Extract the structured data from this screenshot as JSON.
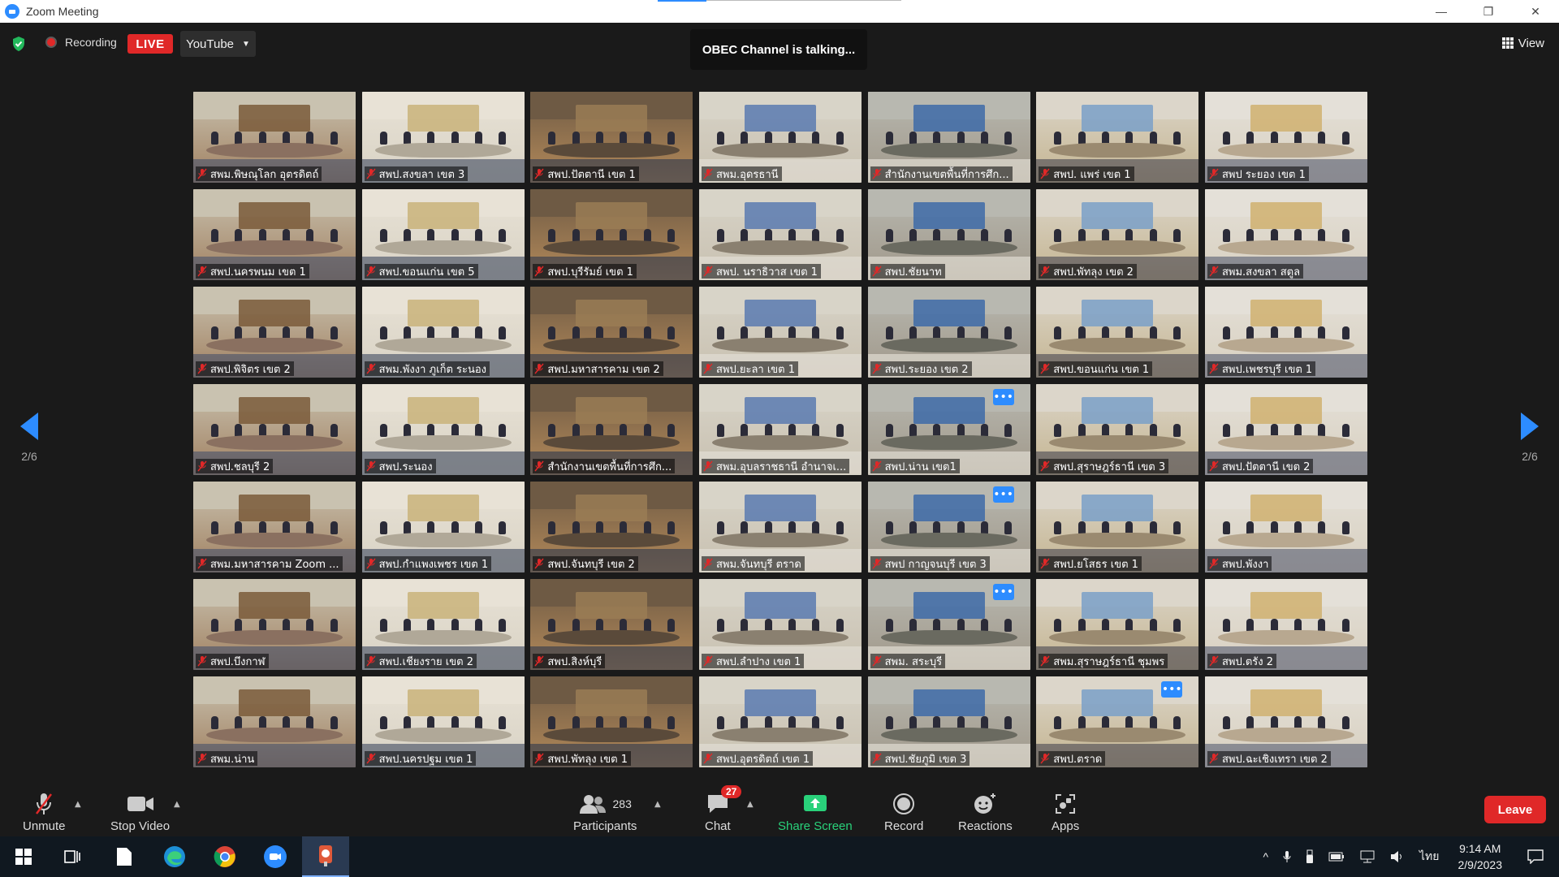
{
  "window": {
    "title": "Zoom Meeting",
    "controls": [
      "—",
      "❐",
      "✕"
    ]
  },
  "topbar": {
    "recording_label": "Recording",
    "live_label": "LIVE",
    "stream_target": "YouTube",
    "talking_status": "OBEC Channel is talking...",
    "view_label": "View"
  },
  "nav": {
    "page_left": "2/6",
    "page_right": "2/6"
  },
  "participants": [
    {
      "name": "สพม.พิษณุโลก อุตรดิตถ์",
      "muted": true,
      "more": false
    },
    {
      "name": "สพป.สงขลา เขต 3",
      "muted": true,
      "more": false
    },
    {
      "name": "สพป.ปัตตานี เขต 1",
      "muted": true,
      "more": false
    },
    {
      "name": "สพม.อุดรธานี",
      "muted": true,
      "more": false
    },
    {
      "name": "สำนักงานเขตพื้นที่การศึก...",
      "muted": true,
      "more": false
    },
    {
      "name": "สพป. แพร่ เขต 1",
      "muted": true,
      "more": false
    },
    {
      "name": "สพป ระยอง เขต 1",
      "muted": true,
      "more": false
    },
    {
      "name": "สพป.นครพนม เขต 1",
      "muted": true,
      "more": false
    },
    {
      "name": "สพป.ขอนแก่น เขต 5",
      "muted": true,
      "more": false
    },
    {
      "name": "สพป.บุรีรัมย์ เขต 1",
      "muted": true,
      "more": false
    },
    {
      "name": "สพป. นราธิวาส เขต 1",
      "muted": true,
      "more": false
    },
    {
      "name": "สพป.ชัยนาท",
      "muted": true,
      "more": false
    },
    {
      "name": "สพป.พัทลุง เขต 2",
      "muted": true,
      "more": false
    },
    {
      "name": "สพม.สงขลา สตูล",
      "muted": true,
      "more": false
    },
    {
      "name": "สพป.พิจิตร เขต 2",
      "muted": true,
      "more": false
    },
    {
      "name": "สพม.พังงา ภูเก็ต ระนอง",
      "muted": true,
      "more": false
    },
    {
      "name": "สพป.มหาสารคาม เขต 2",
      "muted": true,
      "more": false
    },
    {
      "name": "สพป.ยะลา เขต 1",
      "muted": true,
      "more": false
    },
    {
      "name": "สพป.ระยอง เขต 2",
      "muted": true,
      "more": false
    },
    {
      "name": "สพป.ขอนแก่น เขต 1",
      "muted": true,
      "more": false
    },
    {
      "name": "สพป.เพชรบุรี เขต 1",
      "muted": true,
      "more": false
    },
    {
      "name": "สพป.ชลบุรี 2",
      "muted": true,
      "more": false
    },
    {
      "name": "สพป.ระนอง",
      "muted": true,
      "more": false
    },
    {
      "name": "สำนักงานเขตพื้นที่การศึก...",
      "muted": true,
      "more": false
    },
    {
      "name": "สพม.อุบลราชธานี อำนาจเ...",
      "muted": true,
      "more": false
    },
    {
      "name": "สพป.น่าน เขต1",
      "muted": true,
      "more": true
    },
    {
      "name": "สพป.สุราษฎร์ธานี เขต 3",
      "muted": true,
      "more": false
    },
    {
      "name": "สพป.ปัตตานี เขต 2",
      "muted": true,
      "more": false
    },
    {
      "name": "สพม.มหาสารคาม Zoom ...",
      "muted": true,
      "more": false
    },
    {
      "name": "สพป.กำแพงเพชร เขต 1",
      "muted": true,
      "more": false
    },
    {
      "name": "สพป.จันทบุรี เขต 2",
      "muted": true,
      "more": false
    },
    {
      "name": "สพม.จันทบุรี ตราด",
      "muted": true,
      "more": false
    },
    {
      "name": "สพป กาญจนบุรี เขต 3",
      "muted": true,
      "more": true
    },
    {
      "name": "สพป.ยโสธร เขต 1",
      "muted": true,
      "more": false
    },
    {
      "name": "สพป.พังงา",
      "muted": true,
      "more": false
    },
    {
      "name": "สพป.บึงกาฬ",
      "muted": true,
      "more": false
    },
    {
      "name": "สพป.เชียงราย เขต 2",
      "muted": true,
      "more": false
    },
    {
      "name": "สพป.สิงห์บุรี",
      "muted": true,
      "more": false
    },
    {
      "name": "สพป.ลำปาง เขต 1",
      "muted": true,
      "more": false
    },
    {
      "name": "สพม. สระบุรี",
      "muted": true,
      "more": true
    },
    {
      "name": "สพม.สุราษฎร์ธานี ชุมพร",
      "muted": true,
      "more": false
    },
    {
      "name": "สพป.ตรัง 2",
      "muted": true,
      "more": false
    },
    {
      "name": "สพม.น่าน",
      "muted": true,
      "more": false
    },
    {
      "name": "สพป.นครปฐม เขต 1",
      "muted": true,
      "more": false
    },
    {
      "name": "สพป.พัทลุง เขต 1",
      "muted": true,
      "more": false
    },
    {
      "name": "สพป.อุตรดิตถ์ เขต 1",
      "muted": true,
      "more": false
    },
    {
      "name": "สพป.ชัยภูมิ เขต 3",
      "muted": true,
      "more": false
    },
    {
      "name": "สพป.ตราด",
      "muted": true,
      "more": true
    },
    {
      "name": "สพป.ฉะเชิงเทรา เขต 2",
      "muted": true,
      "more": false
    }
  ],
  "toolbar": {
    "unmute": "Unmute",
    "stop_video": "Stop Video",
    "participants_label": "Participants",
    "participants_count": "283",
    "chat_label": "Chat",
    "chat_badge": "27",
    "share_label": "Share Screen",
    "record_label": "Record",
    "reactions_label": "Reactions",
    "apps_label": "Apps",
    "leave_label": "Leave"
  },
  "taskbar": {
    "language": "ไทย",
    "time": "9:14 AM",
    "date": "2/9/2023"
  },
  "colors": {
    "accent": "#2d8cff",
    "live_red": "#e02828",
    "share_green": "#29d17a",
    "background": "#1a1a1a"
  }
}
